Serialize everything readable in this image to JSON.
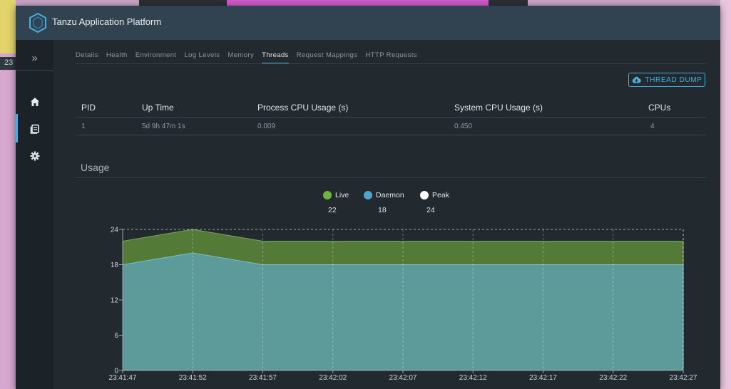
{
  "app": {
    "title": "Tanzu Application Platform"
  },
  "background": {
    "left_text": "23"
  },
  "nav": {
    "toggle": "»"
  },
  "tabs": [
    "Details",
    "Health",
    "Environment",
    "Log Levels",
    "Memory",
    "Threads",
    "Request Mappings",
    "HTTP Requests"
  ],
  "active_tab": "Threads",
  "thread_dump": {
    "label": "THREAD DUMP"
  },
  "table": {
    "headers": [
      "PID",
      "Up Time",
      "Process CPU Usage (s)",
      "System CPU Usage (s)",
      "CPUs"
    ],
    "row": [
      "1",
      "5d 9h 47m 1s",
      "0.009",
      "0.450",
      "4"
    ]
  },
  "usage": {
    "title": "Usage"
  },
  "legend": [
    {
      "name": "Live",
      "value": "22",
      "color": "#6fb33a"
    },
    {
      "name": "Daemon",
      "value": "18",
      "color": "#4fa3d1"
    },
    {
      "name": "Peak",
      "value": "24",
      "color": "#ffffff"
    }
  ],
  "chart_data": {
    "type": "area",
    "x": [
      "23:41:47",
      "23:41:52",
      "23:41:57",
      "23:42:02",
      "23:42:07",
      "23:42:12",
      "23:42:17",
      "23:42:22",
      "23:42:27"
    ],
    "series": [
      {
        "name": "Live",
        "values": [
          22,
          24,
          22,
          22,
          22,
          22,
          22,
          22,
          22
        ],
        "color": "#537a37"
      },
      {
        "name": "Daemon",
        "values": [
          18,
          20,
          18,
          18,
          18,
          18,
          18,
          18,
          18
        ],
        "color": "#5d9b9a"
      },
      {
        "name": "Peak",
        "values": [
          24,
          24,
          24,
          24,
          24,
          24,
          24,
          24,
          24
        ],
        "color": "#ffffff"
      }
    ],
    "yticks": [
      "0",
      "6",
      "12",
      "18",
      "24"
    ],
    "ylim": [
      0,
      24
    ],
    "grid": true
  }
}
